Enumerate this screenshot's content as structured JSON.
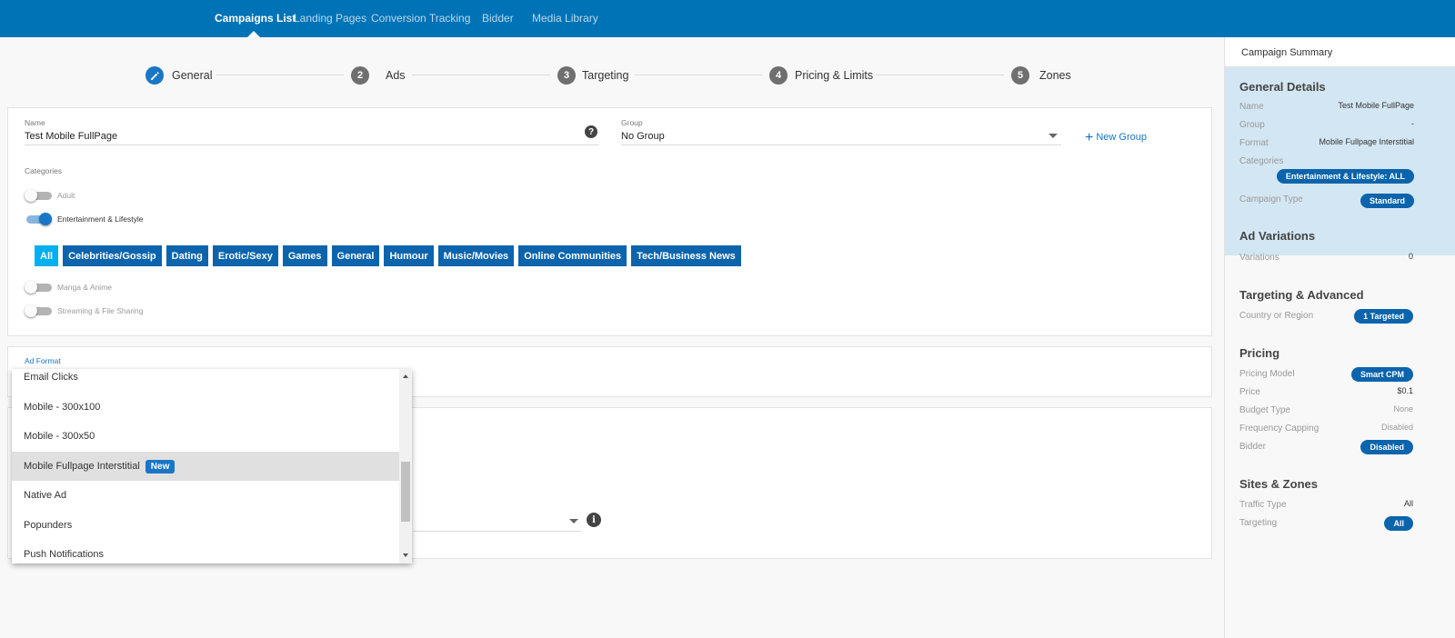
{
  "nav": {
    "items": [
      "Campaigns List",
      "Landing Pages",
      "Conversion Tracking",
      "Bidder",
      "Media Library"
    ],
    "active": "Campaigns List"
  },
  "steps": [
    {
      "num": "",
      "label": "General",
      "active": true
    },
    {
      "num": "2",
      "label": "Ads"
    },
    {
      "num": "3",
      "label": "Targeting"
    },
    {
      "num": "4",
      "label": "Pricing & Limits"
    },
    {
      "num": "5",
      "label": "Zones"
    }
  ],
  "general": {
    "name_label": "Name",
    "name_value": "Test Mobile FullPage",
    "group_label": "Group",
    "group_value": "No Group",
    "new_group": "New Group",
    "categories_label": "Categories",
    "toggles": [
      {
        "label": "Adult",
        "on": false
      },
      {
        "label": "Entertainment & Lifestyle",
        "on": true
      },
      {
        "label": "Manga & Anime",
        "on": false
      },
      {
        "label": "Streaming & File Sharing",
        "on": false
      }
    ],
    "chips": [
      "All",
      "Celebrities/Gossip",
      "Dating",
      "Erotic/Sexy",
      "Games",
      "General",
      "Humour",
      "Music/Movies",
      "Online Communities",
      "Tech/Business News"
    ]
  },
  "ad_format": {
    "label": "Ad Format",
    "options": [
      "Email Clicks",
      "Mobile - 300x100",
      "Mobile - 300x50",
      "Mobile Fullpage Interstitial",
      "Native Ad",
      "Popunders",
      "Push Notifications"
    ],
    "selected": "Mobile Fullpage Interstitial",
    "new_badge": "New"
  },
  "summary": {
    "header": "Campaign Summary",
    "general_title": "General Details",
    "name_label": "Name",
    "name_value": "Test Mobile FullPage",
    "group_label": "Group",
    "group_value": "-",
    "format_label": "Format",
    "format_value": "Mobile Fullpage Interstitial",
    "categories_label": "Categories",
    "categories_value": "Entertainment & Lifestyle: ALL",
    "campaign_type_label": "Campaign Type",
    "campaign_type_value": "Standard",
    "ad_variations_title": "Ad Variations",
    "variations_label": "Variations",
    "variations_value": "0",
    "targeting_title": "Targeting & Advanced",
    "country_label": "Country or Region",
    "country_value": "1 Targeted",
    "pricing_title": "Pricing",
    "pricing_model_label": "Pricing Model",
    "pricing_model_value": "Smart CPM",
    "price_label": "Price",
    "price_value": "$0.1",
    "budget_label": "Budget Type",
    "budget_value": "None",
    "frequency_label": "Frequency Capping",
    "frequency_value": "Disabled",
    "bidder_label": "Bidder",
    "bidder_value": "Disabled",
    "sites_title": "Sites & Zones",
    "traffic_label": "Traffic Type",
    "traffic_value": "All",
    "targeting_label": "Targeting",
    "targeting_value": "All"
  }
}
